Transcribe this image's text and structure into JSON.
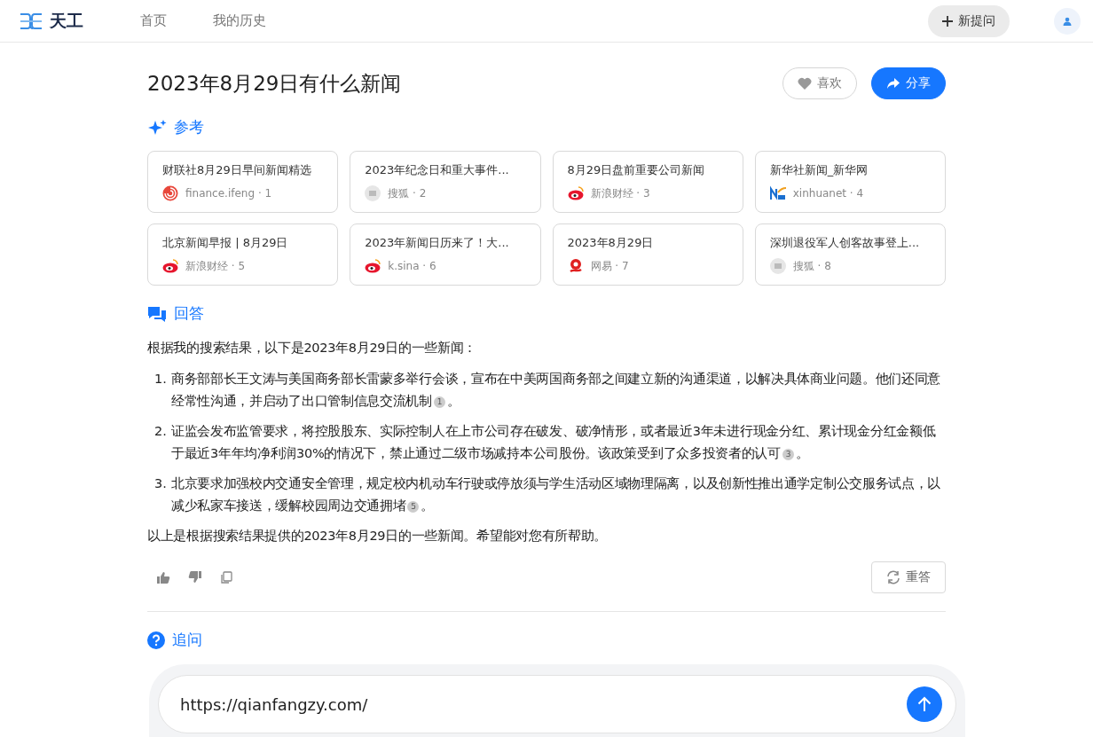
{
  "header": {
    "brand": "天工",
    "nav": [
      {
        "label": "首页",
        "selected": false
      },
      {
        "label": "我的历史",
        "selected": false
      }
    ],
    "new_question": "新提问"
  },
  "question": {
    "title": "2023年8月29日有什么新闻",
    "like": "喜欢",
    "share": "分享"
  },
  "references": {
    "heading": "参考",
    "cards": [
      {
        "title": "财联社8月29日早间新闻精选",
        "source": "finance.ifeng · 1",
        "kind": "ifeng"
      },
      {
        "title": "2023年纪念日和重大事件...",
        "source": "搜狐 · 2",
        "kind": "sohu"
      },
      {
        "title": "8月29日盘前重要公司新闻",
        "source": "新浪财经 · 3",
        "kind": "sina"
      },
      {
        "title": "新华社新闻_新华网",
        "source": "xinhuanet · 4",
        "kind": "xinhua"
      },
      {
        "title": "北京新闻早报 | 8月29日",
        "source": "新浪财经 · 5",
        "kind": "sina"
      },
      {
        "title": "2023年新闻日历来了！大...",
        "source": "k.sina · 6",
        "kind": "sina"
      },
      {
        "title": "2023年8月29日",
        "source": "网易 · 7",
        "kind": "netease"
      },
      {
        "title": "深圳退役军人创客故事登上...",
        "source": "搜狐 · 8",
        "kind": "sohu"
      }
    ]
  },
  "answer": {
    "heading": "回答",
    "intro": "根据我的搜索结果，以下是2023年8月29日的一些新闻：",
    "items": [
      {
        "number": "1.",
        "text": "商务部部长王文涛与美国商务部长雷蒙多举行会谈，宣布在中美两国商务部之间建立新的沟通渠道，以解决具体商业问题。他们还同意经常性沟通，并启动了出口管制信息交流机制",
        "cite": "1",
        "end": "。"
      },
      {
        "number": "2.",
        "text": "证监会发布监管要求，将控股股东、实际控制人在上市公司存在破发、破净情形，或者最近3年未进行现金分红、累计现金分红金额低于最近3年年均净利润30%的情况下，禁止通过二级市场减持本公司股份。该政策受到了众多投资者的认可",
        "cite": "3",
        "end": "。"
      },
      {
        "number": "3.",
        "text": "北京要求加强校内交通安全管理，规定校内机动车行驶或停放须与学生活动区域物理隔离，以及创新性推出通学定制公交服务试点，以减少私家车接送，缓解校园周边交通拥堵",
        "cite": "5",
        "end": "。"
      }
    ],
    "outro": "以上是根据搜索结果提供的2023年8月29日的一些新闻。希望能对您有所帮助。",
    "regenerate": "重答"
  },
  "follow_up": {
    "heading": "追问"
  },
  "input": {
    "value": "https://qianfangzy.com/"
  }
}
